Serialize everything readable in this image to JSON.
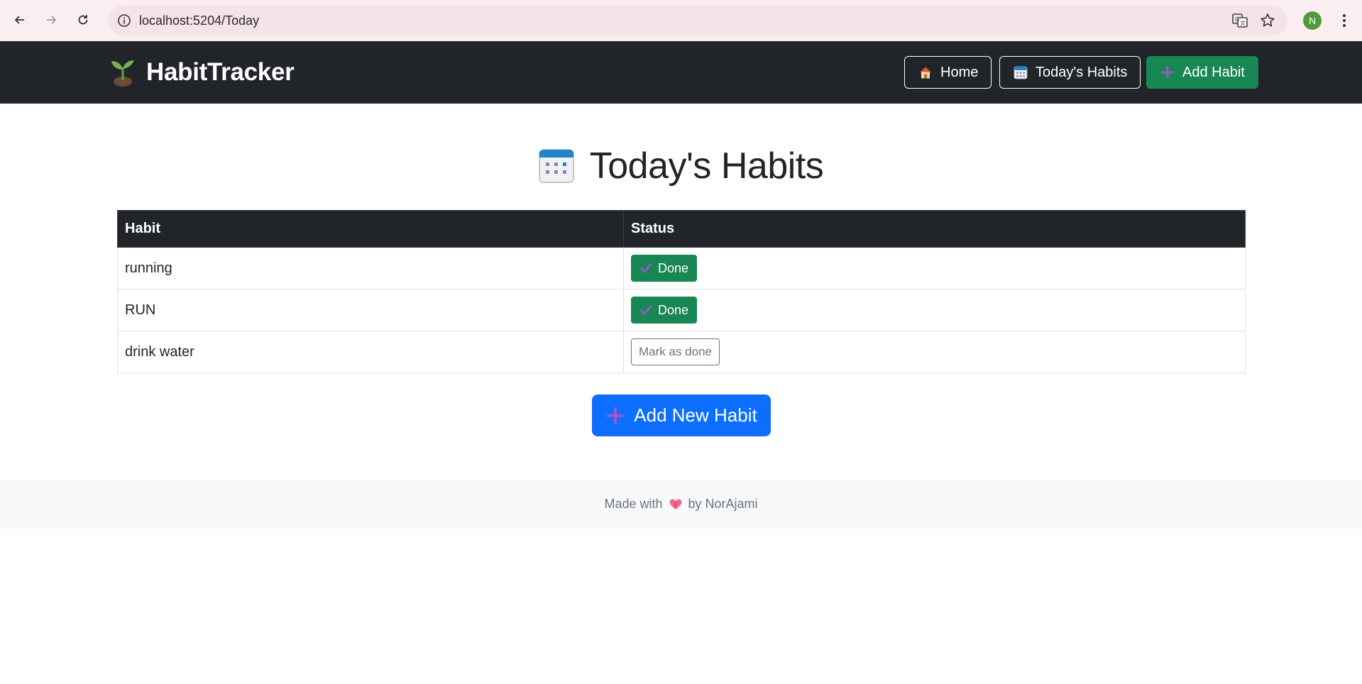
{
  "browser": {
    "url": "localhost:5204/Today",
    "profile_initial": "N"
  },
  "navbar": {
    "brand": "HabitTracker",
    "links": [
      {
        "label": "Home",
        "icon": "house-icon"
      },
      {
        "label": "Today's Habits",
        "icon": "calendar-icon"
      },
      {
        "label": "Add Habit",
        "icon": "plus-icon"
      }
    ]
  },
  "main": {
    "title": "Today's Habits",
    "table": {
      "headers": [
        "Habit",
        "Status"
      ],
      "rows": [
        {
          "habit": "running",
          "status": "Done",
          "done": true
        },
        {
          "habit": "RUN",
          "status": "Done",
          "done": true
        },
        {
          "habit": "drink water",
          "status": "Mark as done",
          "done": false
        }
      ]
    },
    "add_button": "Add New Habit"
  },
  "footer": {
    "prefix": "Made with",
    "suffix": "by NorAjami"
  },
  "colors": {
    "navbar": "#212529",
    "success": "#198754",
    "primary": "#0d6efd",
    "footer_bg": "#f8f9fa"
  }
}
